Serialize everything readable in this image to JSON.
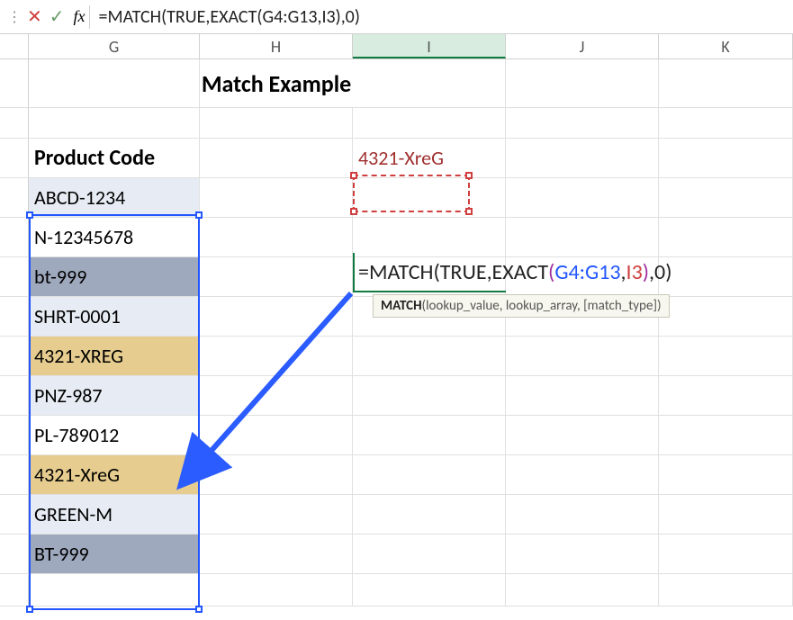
{
  "formula_bar": {
    "fx_label": "fx",
    "formula": "=MATCH(TRUE,EXACT(G4:G13,I3),0)"
  },
  "columns": [
    "G",
    "H",
    "I",
    "J",
    "K"
  ],
  "page_title": "Match Example",
  "table": {
    "header": "Product Code",
    "rows": [
      "ABCD-1234",
      "N-12345678",
      "bt-999",
      "SHRT-0001",
      "4321-XREG",
      "PNZ-987",
      "PL-789012",
      "4321-XreG",
      "GREEN-M",
      "BT-999"
    ]
  },
  "lookup_value": "4321-XreG",
  "cell_formula": {
    "parts": {
      "p1": "=MATCH",
      "p2": "(",
      "p3": "TRUE,EXACT",
      "p4": "(",
      "p5": "G4:G13",
      "p6": ",",
      "p7": "I3",
      "p8": ")",
      "p9": ",0",
      "p10": ")"
    }
  },
  "tooltip": {
    "fn": "MATCH",
    "sig": "(lookup_value, lookup_array, [match_type])"
  }
}
